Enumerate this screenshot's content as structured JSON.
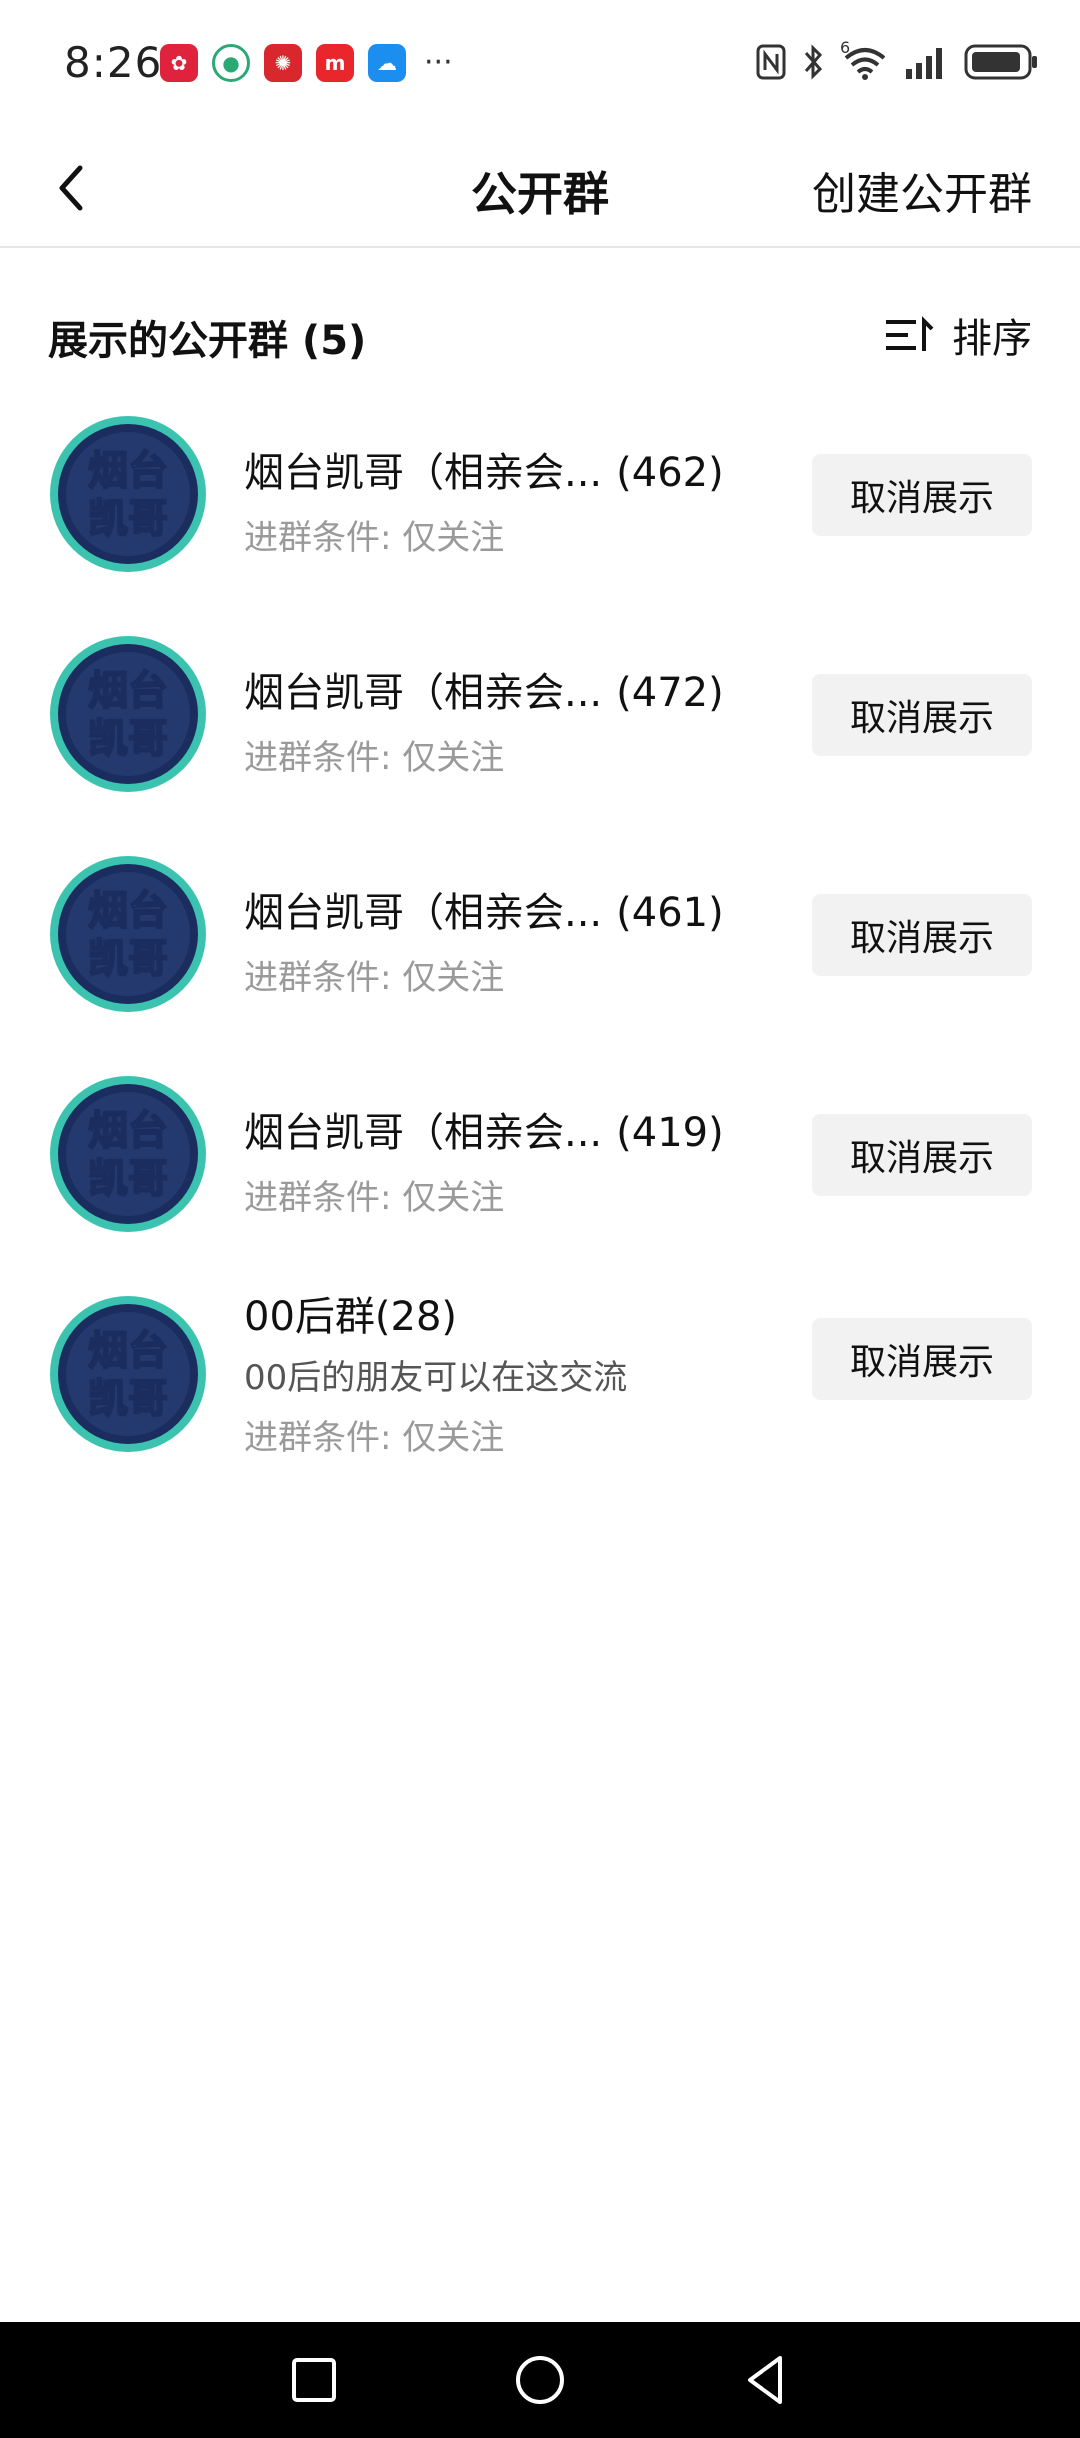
{
  "status": {
    "time": "8:26",
    "more": "···",
    "network": "6"
  },
  "header": {
    "title": "公开群",
    "create_label": "创建公开群"
  },
  "section": {
    "title": "展示的公开群 (5)",
    "sort_label": "排序"
  },
  "groups": [
    {
      "name": "烟台凯哥（相亲会...",
      "count": "(462)",
      "condition": "进群条件: 仅关注",
      "action": "取消展示",
      "avatar_text_top": "烟台",
      "avatar_text_bottom": "凯哥"
    },
    {
      "name": "烟台凯哥（相亲会...",
      "count": "(472)",
      "condition": "进群条件: 仅关注",
      "action": "取消展示",
      "avatar_text_top": "烟台",
      "avatar_text_bottom": "凯哥"
    },
    {
      "name": "烟台凯哥（相亲会...",
      "count": "(461)",
      "condition": "进群条件: 仅关注",
      "action": "取消展示",
      "avatar_text_top": "烟台",
      "avatar_text_bottom": "凯哥"
    },
    {
      "name": "烟台凯哥（相亲会...",
      "count": "(419)",
      "condition": "进群条件: 仅关注",
      "action": "取消展示",
      "avatar_text_top": "烟台",
      "avatar_text_bottom": "凯哥"
    },
    {
      "name": "00后群(28)",
      "description": "00后的朋友可以在这交流",
      "condition": "进群条件: 仅关注",
      "action": "取消展示",
      "avatar_text_top": "烟台",
      "avatar_text_bottom": "凯哥"
    }
  ],
  "colors": {
    "avatar_ring": "#3cc3b0",
    "avatar_bg": "#243a6e",
    "avatar_text": "#ffffff",
    "button_bg": "#f2f2f2",
    "navbar_bg": "#000000"
  }
}
